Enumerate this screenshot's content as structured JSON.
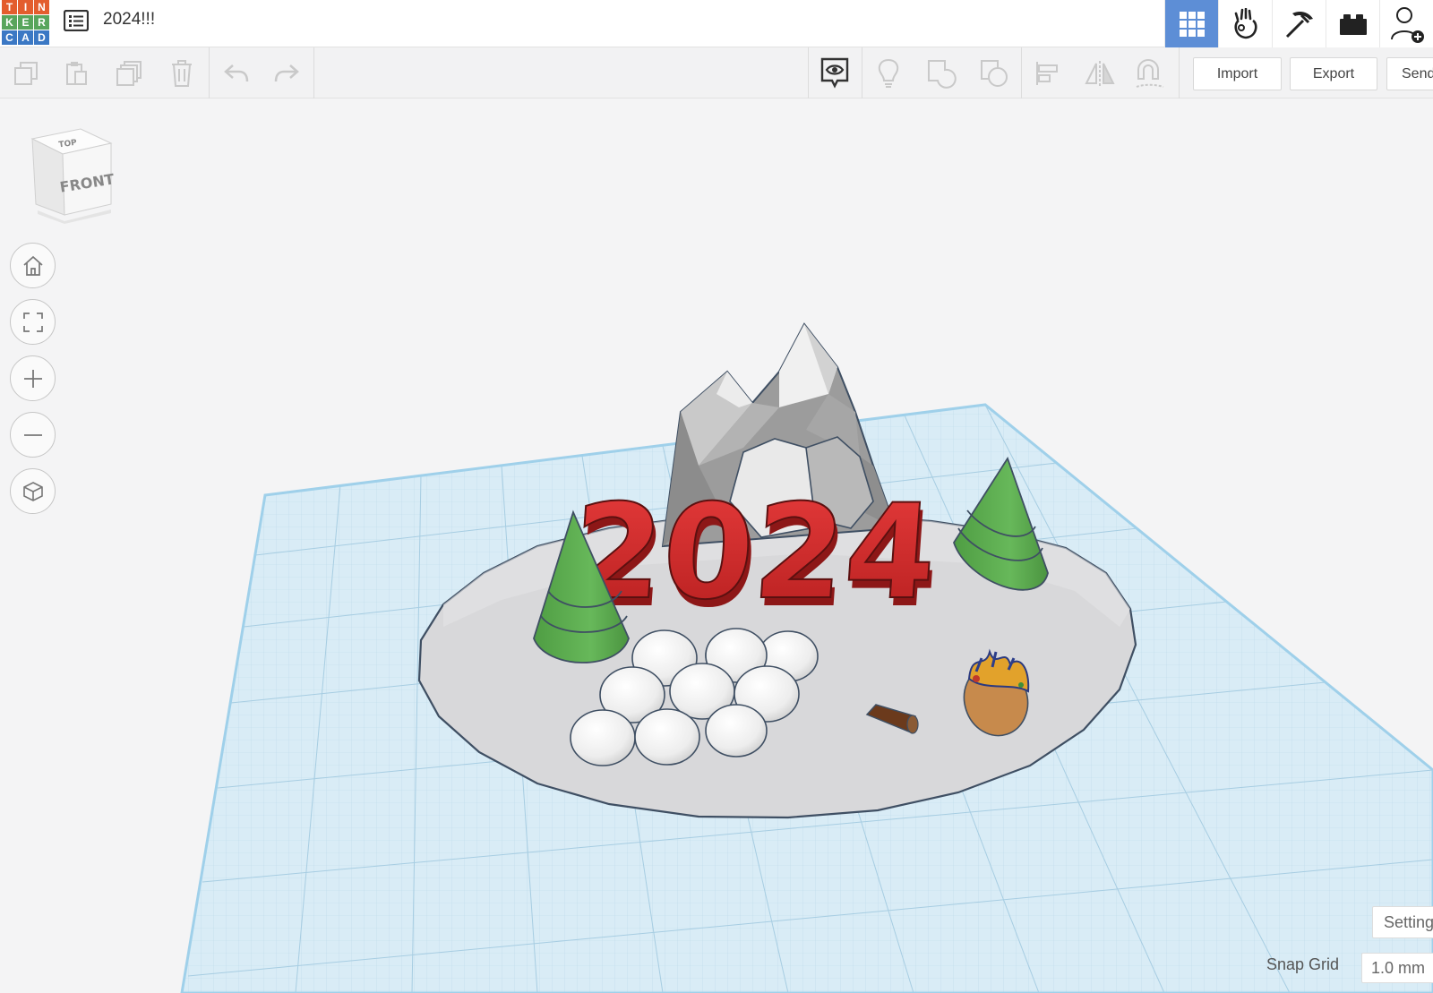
{
  "app": {
    "logo_letters": [
      "T",
      "I",
      "N",
      "K",
      "E",
      "R",
      "C",
      "A",
      "D"
    ],
    "logo_colors": [
      "#e35d2e",
      "#e35d2e",
      "#e35d2e",
      "#58a55c",
      "#58a55c",
      "#58a55c",
      "#3b78c4",
      "#3b78c4",
      "#3b78c4"
    ],
    "design_title": "2024!!!",
    "accent": "#5d8ed6"
  },
  "top_nav": [
    {
      "name": "3d-design-view-icon",
      "active": true
    },
    {
      "name": "blocks-view-icon",
      "active": false
    },
    {
      "name": "bricks-view-icon",
      "active": false
    },
    {
      "name": "lego-view-icon",
      "active": false
    },
    {
      "name": "invite-user-icon",
      "active": false
    }
  ],
  "toolbar": {
    "edit_tools": [
      "copy-icon",
      "paste-icon",
      "duplicate-icon",
      "delete-icon",
      "undo-icon",
      "redo-icon"
    ],
    "shape_tools": [
      "show-all-icon",
      "notes-icon",
      "group-icon",
      "ungroup-icon",
      "align-icon",
      "mirror-icon",
      "cruise-icon"
    ],
    "import_label": "Import",
    "export_label": "Export",
    "send_label": "Send To"
  },
  "view_cube": {
    "top_label": "TOP",
    "front_label": "FRONT"
  },
  "nav_controls": [
    "home-view-icon",
    "fit-all-icon",
    "zoom-in-icon",
    "zoom-out-icon",
    "orthographic-icon"
  ],
  "scene": {
    "text_shape": "2024",
    "text_color": "#d22d2d",
    "tree_color": "#5aa84b",
    "workplane_color": "#d6eaf5"
  },
  "footer": {
    "settings_label": "Settings",
    "snap_grid_label": "Snap Grid",
    "snap_grid_value": "1.0 mm"
  }
}
